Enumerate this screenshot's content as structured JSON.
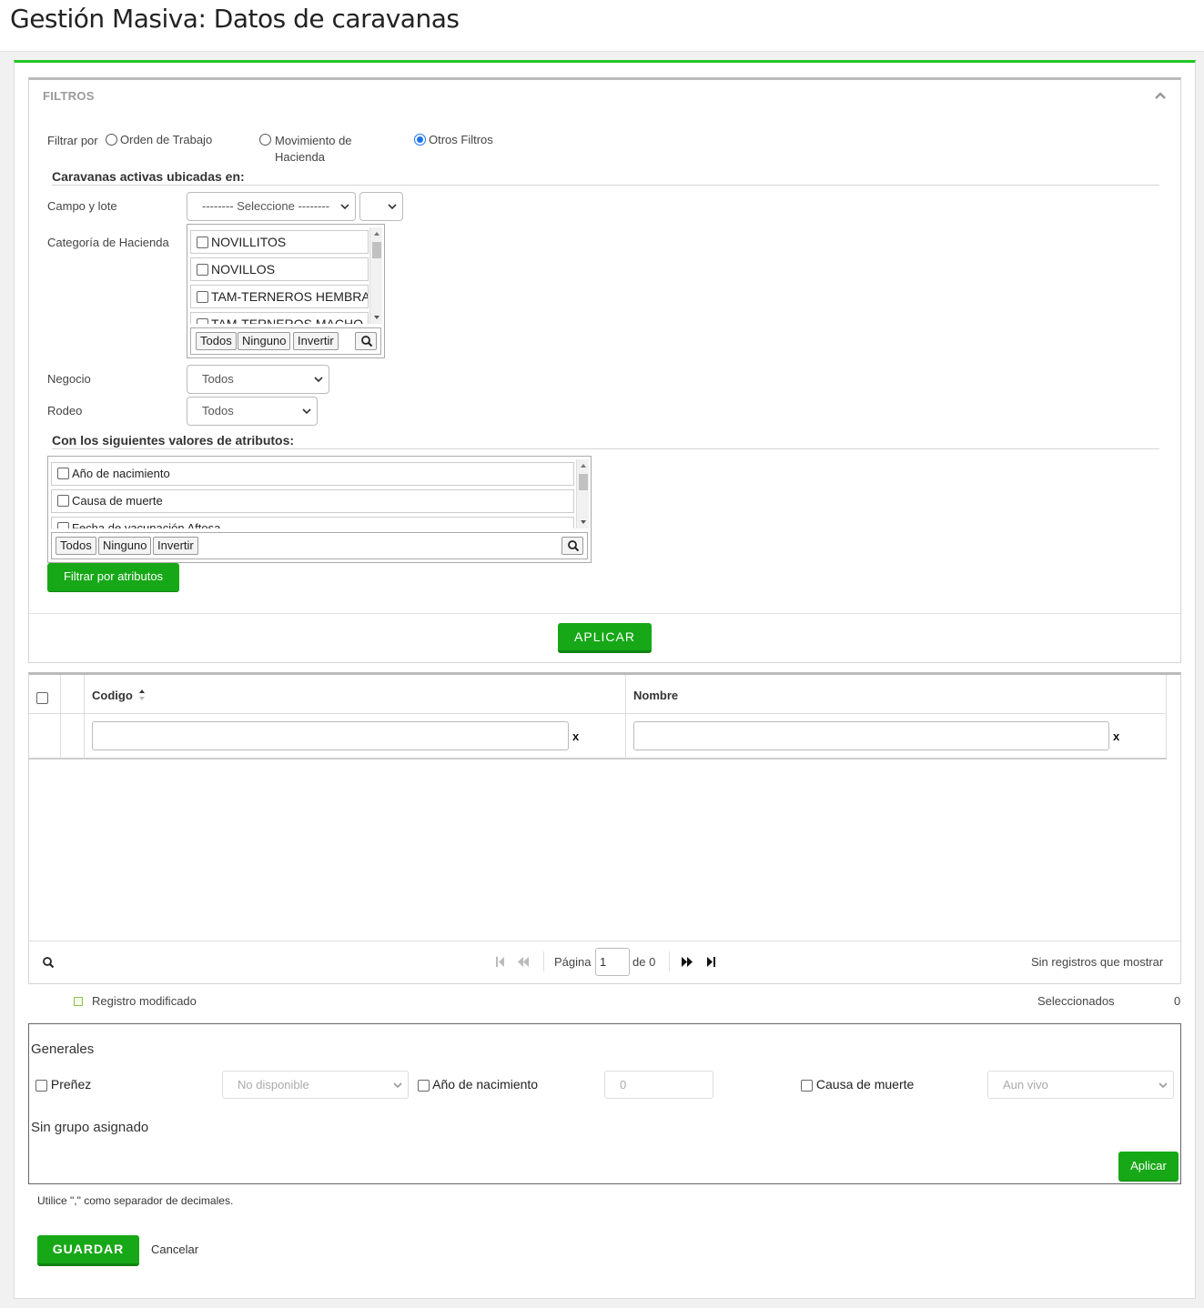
{
  "page": {
    "title": "Gestión Masiva: Datos de caravanas"
  },
  "filters": {
    "title": "FILTROS",
    "filter_by_label": "Filtrar por",
    "radios": [
      {
        "label": "Orden de Trabajo",
        "selected": false
      },
      {
        "label": "Movimiento de Hacienda",
        "selected": false
      },
      {
        "label": "Otros Filtros",
        "selected": true
      }
    ],
    "section_location": "Caravanas activas ubicadas en:",
    "campo_label": "Campo y lote",
    "campo_value": "-------- Seleccione --------",
    "categoria_label": "Categoría de Hacienda",
    "categoria_items": [
      "NOVILLITOS",
      "NOVILLOS",
      "TAM-TERNEROS HEMBRA",
      "TAM-TERNEROS MACHO"
    ],
    "list_buttons": {
      "all": "Todos",
      "none": "Ninguno",
      "invert": "Invertir"
    },
    "negocio_label": "Negocio",
    "negocio_value": "Todos",
    "rodeo_label": "Rodeo",
    "rodeo_value": "Todos",
    "section_attributes": "Con los siguientes valores de atributos:",
    "attribute_items": [
      "Año de nacimiento",
      "Causa de muerte",
      "Fecha de vacunación Aftosa"
    ],
    "filter_attributes_button": "Filtrar por atributos",
    "apply_button": "APLICAR"
  },
  "grid": {
    "columns": [
      "Codigo",
      "Nombre"
    ],
    "clear_label": "x",
    "pager": {
      "page_label": "Página",
      "page_value": "1",
      "of_label": "de 0",
      "empty_text": "Sin registros que mostrar"
    }
  },
  "legend": {
    "modified_label": "Registro modificado",
    "selected_label": "Seleccionados",
    "selected_count": "0"
  },
  "generales": {
    "title": "Generales",
    "fields": [
      {
        "label": "Preñez",
        "value": "No disponible"
      },
      {
        "label": "Año de nacimiento",
        "value": "0"
      },
      {
        "label": "Causa de muerte",
        "value": "Aun vivo"
      }
    ],
    "group_text": "Sin grupo asignado",
    "apply_button": "Aplicar"
  },
  "footer": {
    "note": "Utilice \",\" como separador de decimales.",
    "save_button": "GUARDAR",
    "cancel_link": "Cancelar"
  },
  "colors": {
    "accent_green": "#17a817",
    "top_border_green": "#22c522",
    "radio_blue": "#1a73e8"
  }
}
